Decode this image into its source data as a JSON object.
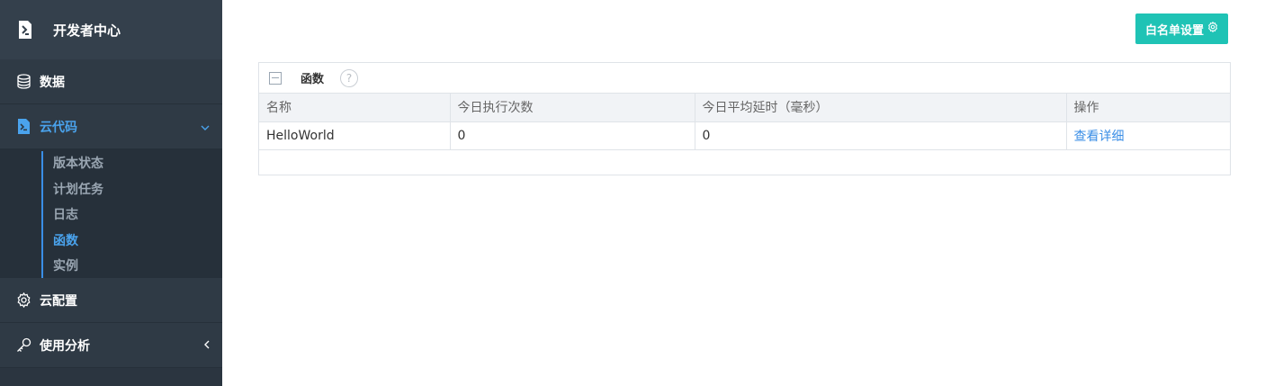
{
  "sidebar": {
    "brand": "开发者中心",
    "items": [
      {
        "label": "数据",
        "icon": "database-icon"
      },
      {
        "label": "云代码",
        "icon": "cloud-code-icon"
      },
      {
        "label": "云配置",
        "icon": "gear-icon"
      },
      {
        "label": "使用分析",
        "icon": "key-icon"
      }
    ],
    "sub_items": [
      "版本状态",
      "计划任务",
      "日志",
      "函数",
      "实例"
    ],
    "active_sub_item": "函数"
  },
  "header": {
    "whitelist_button": "白名单设置"
  },
  "panel": {
    "title": "函数",
    "help": "?",
    "columns": [
      "名称",
      "今日执行次数",
      "今日平均延时（毫秒）",
      "操作"
    ],
    "rows": [
      {
        "name": "HelloWorld",
        "count": "0",
        "latency": "0",
        "action": "查看详细"
      }
    ]
  },
  "colors": {
    "accent": "#1fc3b5",
    "link": "#3a8ee6",
    "sidebar": "#2b3540"
  }
}
